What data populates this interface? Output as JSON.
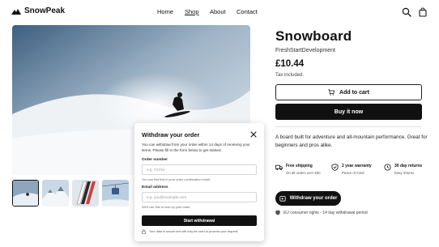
{
  "header": {
    "brand": "SnowPeak",
    "nav": [
      "Home",
      "Shop",
      "About",
      "Contact"
    ],
    "icons": [
      "search-icon",
      "shopping-bag-icon"
    ]
  },
  "gallery": {
    "thumb_count": 4,
    "selected_thumb": 1
  },
  "product": {
    "title": "Snowboard",
    "vendor": "FreshStartDevelopment",
    "price": "£10.44",
    "tax_note": "Tax included.",
    "add_to_cart": "Add to cart",
    "buy_now": "Buy it now",
    "description": "A board built for adventure and all-mountain performance. Great for beginners and pros alike."
  },
  "features": [
    {
      "title": "Free shipping",
      "subtitle": "On all orders over £50",
      "icon": "truck-icon"
    },
    {
      "title": "2 year warranty",
      "subtitle": "Peace of mind",
      "icon": "shield-check-icon"
    },
    {
      "title": "30 day returns",
      "subtitle": "Easy returns",
      "icon": "return-icon"
    }
  ],
  "withdraw_button": "Withdraw your order",
  "eu_note": "EU consumer rights - 14 day withdrawal period",
  "modal": {
    "title": "Withdraw your order",
    "intro": "You can withdraw from your order within 14 days of receiving your items. Please fill in the form below to get started.",
    "order_label": "Order number",
    "order_placeholder": "e.g. #1234",
    "order_hint": "You can find this in your order confirmation email.",
    "email_label": "Email address",
    "email_placeholder": "e.g. you@example.com",
    "email_hint": "We'll use this to look up your order.",
    "submit": "Start withdrawal",
    "secure_note": "Your data is secure and will only be used to process your request."
  },
  "colors": {
    "primary": "#111111",
    "background": "#ffffff",
    "border": "#d6d6d6",
    "muted_text": "#555555"
  }
}
